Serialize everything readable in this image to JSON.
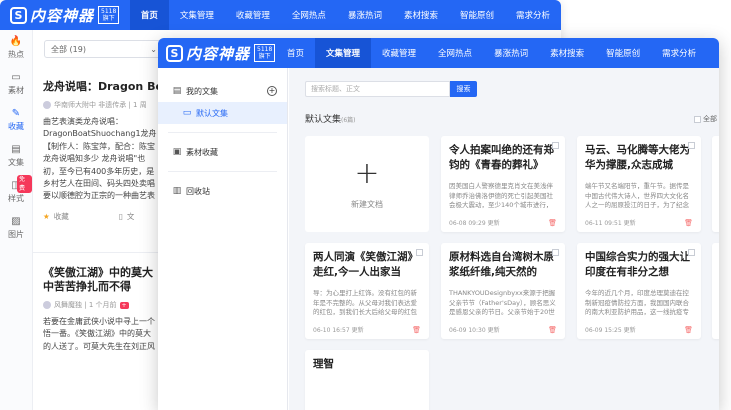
{
  "brand": {
    "mark": "S",
    "name": "内容神器",
    "badge_line1": "5118",
    "badge_line2": "旗下"
  },
  "nav": [
    "首页",
    "文集管理",
    "收藏管理",
    "全网热点",
    "暴涨热词",
    "素材搜索",
    "智能原创",
    "需求分析"
  ],
  "back": {
    "sidebar": [
      {
        "label": "热点",
        "icon": "flame-icon",
        "glyph": "🔥"
      },
      {
        "label": "素材",
        "icon": "folder-icon",
        "glyph": "▭"
      },
      {
        "label": "收藏",
        "icon": "bookmark-icon",
        "glyph": "✎"
      },
      {
        "label": "文集",
        "icon": "document-icon",
        "glyph": "▤"
      },
      {
        "label": "样式",
        "icon": "style-icon",
        "glyph": "◫",
        "tag": "免费"
      },
      {
        "label": "图片",
        "icon": "image-icon",
        "glyph": "▨"
      }
    ],
    "filter": {
      "label": "全部 (19)",
      "arrow": "⌄"
    },
    "articles": [
      {
        "title": "龙舟说唱：Dragon Bo",
        "author": "华南师大附中 非遗传承",
        "time": "1 周",
        "lines": [
          "曲艺表演类龙舟说唱：",
          "DragonBoatShuochang1龙舟",
          "【制作人：陈宝萍，配合：陈宝",
          "龙舟说唱知多少 龙舟说唱\"也",
          "初，至今已有400多年历史，是",
          "乡村艺人在田间、码头四处卖唱",
          "要以顺德腔为正宗的一种曲艺表"
        ],
        "collect": "收藏",
        "extra": "文"
      },
      {
        "title_l1": "《笑傲江湖》中的莫大",
        "title_l2": "中苦苦挣扎而不得",
        "author": "风舞魔独",
        "time": "1 个月前",
        "lines": [
          "若要在金庸武侠小说中寻上一个",
          "悟一番。《笑傲江湖》中的莫大",
          "的人送了。可莫大先生在刘正风"
        ]
      }
    ]
  },
  "front": {
    "panel": {
      "my_docs": "我的文集",
      "default": "默认文集",
      "favorites": "素材收藏",
      "recycle": "回收站"
    },
    "search_placeholder": "搜索标题、正文",
    "search_btn": "搜索",
    "title": "默认文集",
    "count": "(6篇)",
    "select_all": "全部",
    "new_doc": "新建文档",
    "cards": [
      {
        "title": "令人拍案叫绝的还有郑钧的《青春的葬礼》",
        "text": "因美国白人警察德里克肖文在美浅伴律师乔治佛洛伊德的死亡引起美国社会极大震动，至少140个城市进行，四面都有乔佛洛伊德的抗议",
        "date": "06-08 09:29",
        "action": "更新"
      },
      {
        "title": "马云、马化腾等大佬为华为撑腰,众志成城下,…",
        "text": "端午节又名端阳节，重午节。据传是中国古代伟大诗人，世界四大文化名人之一的屈原投江的日子，为了纪念屈原",
        "date": "06-11 09:51",
        "action": "更新"
      },
      {
        "title": "两人同演《笑傲江湖》走红,今一人出家当和…",
        "text": "导：为心里打上红饰。没有红包的新年是不完整的。从父母对我们表达爱的红包，到我们长大后给父母的红包",
        "date": "06-10 16:57",
        "action": "更新"
      },
      {
        "title": "原材料选自台湾树木原浆纸纤维,纯天然的食…",
        "text": "THANKYOUDesignbyxx来源于把握父亲节节（Father'sDay），顾名思义是感恩父亲的节日。父亲节始于20世纪初",
        "date": "06-09 10:30",
        "action": "更新"
      },
      {
        "title": "中国综合实力的强大让印度在有非分之想时,…",
        "text": "今年的近几个月，印度总理莫迪在控制新冠疫情防控方面，我国国内联合的南大利亚防护用品，这一线抗疫专家组和13项",
        "date": "06-09 15:25",
        "action": "更新"
      },
      {
        "title": "理智"
      }
    ]
  }
}
